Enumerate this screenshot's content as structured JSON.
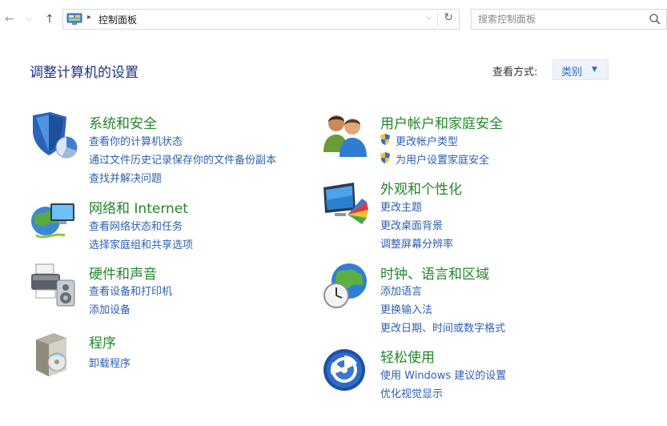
{
  "address_bar": {
    "back_icon": "arrow-left-icon",
    "history_icon": "chevron-down-icon",
    "up_icon": "arrow-up-icon",
    "location_icon": "control-panel-icon",
    "breadcrumb": "控制面板",
    "refresh_icon": "refresh-icon"
  },
  "search": {
    "placeholder": "搜索控制面板",
    "icon": "search-icon"
  },
  "header": {
    "title": "调整计算机的设置",
    "view_by_label": "查看方式:",
    "view_by_value": "类别"
  },
  "categories": [
    {
      "icon": "shield-pie-icon",
      "title": "系统和安全",
      "links": [
        "查看你的计算机状态",
        "通过文件历史记录保存你的文件备份副本",
        "查找并解决问题"
      ]
    },
    {
      "icon": "network-globe-icon",
      "title": "网络和 Internet",
      "links": [
        "查看网络状态和任务",
        "选择家庭组和共享选项"
      ]
    },
    {
      "icon": "printer-speaker-icon",
      "title": "硬件和声音",
      "links": [
        "查看设备和打印机",
        "添加设备"
      ]
    },
    {
      "icon": "program-box-icon",
      "title": "程序",
      "links": [
        "卸载程序"
      ]
    },
    {
      "icon": "users-icon",
      "title": "用户帐户和家庭安全",
      "links": [
        "更改帐户类型",
        "为用户设置家庭安全"
      ],
      "link_icon": "uac-shield-icon"
    },
    {
      "icon": "display-palette-icon",
      "title": "外观和个性化",
      "links": [
        "更改主题",
        "更改桌面背景",
        "调整屏幕分辨率"
      ]
    },
    {
      "icon": "clock-globe-icon",
      "title": "时钟、语言和区域",
      "links": [
        "添加语言",
        "更换输入法",
        "更改日期、时间或数字格式"
      ]
    },
    {
      "icon": "ease-of-access-icon",
      "title": "轻松使用",
      "links": [
        "使用 Windows 建议的设置",
        "优化视觉显示"
      ]
    }
  ],
  "colors": {
    "category_title": "#23862a",
    "link": "#2d5fb0",
    "page_title": "#1e3287",
    "view_select_bg": "#eef3fa"
  }
}
